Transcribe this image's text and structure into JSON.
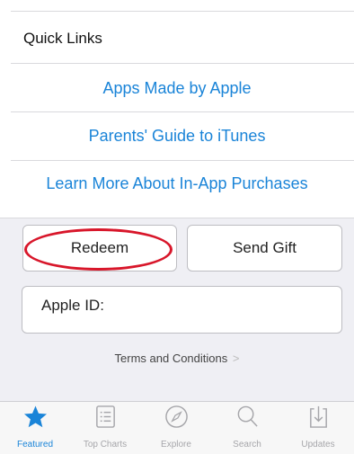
{
  "quick_links": {
    "title": "Quick Links",
    "links": [
      "Apps Made by Apple",
      "Parents' Guide to iTunes",
      "Learn More About In-App Purchases"
    ]
  },
  "actions": {
    "redeem_label": "Redeem",
    "send_gift_label": "Send Gift"
  },
  "apple_id": {
    "label": "Apple ID:"
  },
  "terms": {
    "label": "Terms and Conditions",
    "chevron": ">"
  },
  "tabbar": {
    "active_color": "#1a84d8",
    "inactive_color": "#a6a6aa",
    "tabs": [
      {
        "label": "Featured",
        "icon": "star-icon"
      },
      {
        "label": "Top Charts",
        "icon": "list-icon"
      },
      {
        "label": "Explore",
        "icon": "compass-icon"
      },
      {
        "label": "Search",
        "icon": "search-icon"
      },
      {
        "label": "Updates",
        "icon": "download-icon"
      }
    ]
  },
  "annotation": {
    "color": "#d8162a"
  }
}
